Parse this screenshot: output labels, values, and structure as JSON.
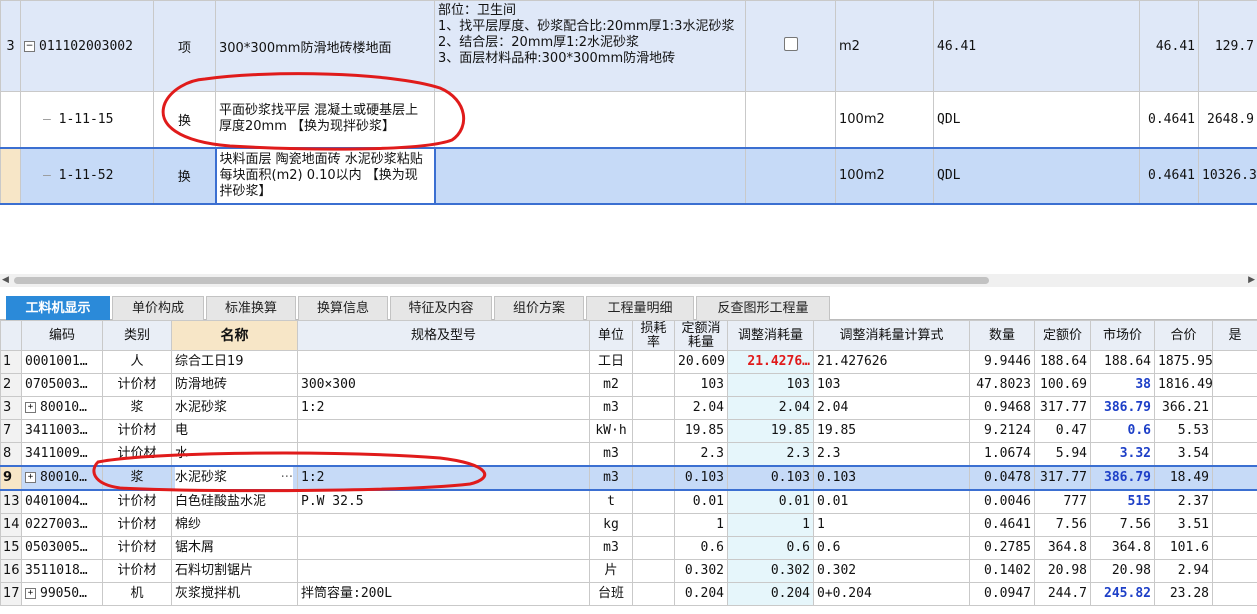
{
  "top_rows": [
    {
      "num": "3",
      "code": "011102003002",
      "type": "项",
      "name": "300*300mm防滑地砖楼地面",
      "feature": "部位：卫生间\n1、找平层厚度、砂浆配合比:20mm厚1:3水泥砂浆\n2、结合层：20mm厚1:2水泥砂浆\n3、面层材料品种:300*300mm防滑地砖",
      "unit": "m2",
      "qty_expr": "46.41",
      "qty": "46.41",
      "price": "129.7"
    },
    {
      "num": "",
      "code": "1-11-15",
      "type": "换",
      "name": "平面砂浆找平层 混凝土或硬基层上 厚度20mm 【换为现拌砂浆】",
      "feature": "",
      "unit": "100m2",
      "qty_expr": "QDL",
      "qty": "0.4641",
      "price": "2648.9"
    },
    {
      "num": "",
      "code": "1-11-52",
      "type": "换",
      "name": "块料面层 陶瓷地面砖 水泥砂浆粘贴 每块面积(m2) 0.10以内 【换为现拌砂浆】",
      "feature": "",
      "unit": "100m2",
      "qty_expr": "QDL",
      "qty": "0.4641",
      "price": "10326.3"
    }
  ],
  "tabs": [
    "工料机显示",
    "单价构成",
    "标准换算",
    "换算信息",
    "特征及内容",
    "组价方案",
    "工程量明细",
    "反查图形工程量"
  ],
  "headers": {
    "code": "编码",
    "cat": "类别",
    "name": "名称",
    "spec": "规格及型号",
    "unit": "单位",
    "loss": "损耗率",
    "quota": "定额消耗量",
    "adj": "调整消耗量",
    "formula": "调整消耗量计算式",
    "qty": "数量",
    "qprice": "定额价",
    "mprice": "市场价",
    "total": "合价",
    "extra": "是"
  },
  "rows": [
    {
      "n": "1",
      "code": "0001001…",
      "cat": "人",
      "name": "综合工日19",
      "spec": "",
      "unit": "工日",
      "loss": "",
      "quota": "20.609",
      "adj": "21.4276…",
      "formula": "21.427626",
      "qty": "9.9446",
      "qprice": "188.64",
      "mprice": "188.64",
      "total": "1875.95"
    },
    {
      "n": "2",
      "code": "0705003…",
      "cat": "计价材",
      "name": "防滑地砖",
      "spec": "300×300",
      "unit": "m2",
      "loss": "",
      "quota": "103",
      "adj": "103",
      "formula": "103",
      "qty": "47.8023",
      "qprice": "100.69",
      "mprice": "38",
      "total": "1816.49"
    },
    {
      "n": "3",
      "code": "80010…",
      "cat": "浆",
      "name": "水泥砂浆",
      "spec": "1:2",
      "unit": "m3",
      "loss": "",
      "quota": "2.04",
      "adj": "2.04",
      "formula": "2.04",
      "qty": "0.9468",
      "qprice": "317.77",
      "mprice": "386.79",
      "total": "366.21"
    },
    {
      "n": "7",
      "code": "3411003…",
      "cat": "计价材",
      "name": "电",
      "spec": "",
      "unit": "kW·h",
      "loss": "",
      "quota": "19.85",
      "adj": "19.85",
      "formula": "19.85",
      "qty": "9.2124",
      "qprice": "0.47",
      "mprice": "0.6",
      "total": "5.53"
    },
    {
      "n": "8",
      "code": "3411009…",
      "cat": "计价材",
      "name": "水",
      "spec": "",
      "unit": "m3",
      "loss": "",
      "quota": "2.3",
      "adj": "2.3",
      "formula": "2.3",
      "qty": "1.0674",
      "qprice": "5.94",
      "mprice": "3.32",
      "total": "3.54"
    },
    {
      "n": "9",
      "code": "80010…",
      "cat": "浆",
      "name": "水泥砂浆",
      "spec": "1:2",
      "unit": "m3",
      "loss": "",
      "quota": "0.103",
      "adj": "0.103",
      "formula": "0.103",
      "qty": "0.0478",
      "qprice": "317.77",
      "mprice": "386.79",
      "total": "18.49"
    },
    {
      "n": "13",
      "code": "0401004…",
      "cat": "计价材",
      "name": "白色硅酸盐水泥",
      "spec": "P.W 32.5",
      "unit": "t",
      "loss": "",
      "quota": "0.01",
      "adj": "0.01",
      "formula": "0.01",
      "qty": "0.0046",
      "qprice": "777",
      "mprice": "515",
      "total": "2.37"
    },
    {
      "n": "14",
      "code": "0227003…",
      "cat": "计价材",
      "name": "棉纱",
      "spec": "",
      "unit": "kg",
      "loss": "",
      "quota": "1",
      "adj": "1",
      "formula": "1",
      "qty": "0.4641",
      "qprice": "7.56",
      "mprice": "7.56",
      "total": "3.51"
    },
    {
      "n": "15",
      "code": "0503005…",
      "cat": "计价材",
      "name": "锯木屑",
      "spec": "",
      "unit": "m3",
      "loss": "",
      "quota": "0.6",
      "adj": "0.6",
      "formula": "0.6",
      "qty": "0.2785",
      "qprice": "364.8",
      "mprice": "364.8",
      "total": "101.6"
    },
    {
      "n": "16",
      "code": "3511018…",
      "cat": "计价材",
      "name": "石料切割锯片",
      "spec": "",
      "unit": "片",
      "loss": "",
      "quota": "0.302",
      "adj": "0.302",
      "formula": "0.302",
      "qty": "0.1402",
      "qprice": "20.98",
      "mprice": "20.98",
      "total": "2.94"
    },
    {
      "n": "17",
      "code": "99050…",
      "cat": "机",
      "name": "灰浆搅拌机",
      "spec": "拌筒容量:200L",
      "unit": "台班",
      "loss": "",
      "quota": "0.204",
      "adj": "0.204",
      "formula": "0+0.204",
      "qty": "0.0947",
      "qprice": "244.7",
      "mprice": "245.82",
      "total": "23.28"
    }
  ],
  "colors": {
    "selection": "#c6daf7",
    "tab_active": "#2b8ad9",
    "market_price_changed": "#1d3fc7",
    "adjusted_red": "#e01b1b",
    "annotation": "#e01b1b"
  }
}
